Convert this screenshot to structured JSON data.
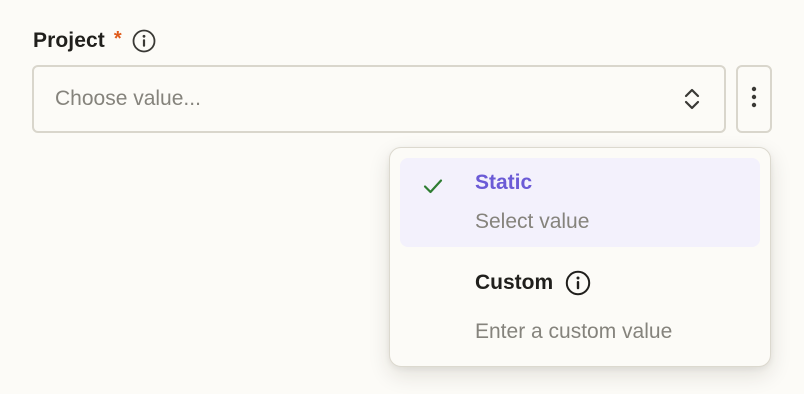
{
  "field": {
    "label": "Project",
    "required_marker": "*",
    "info_icon": "info-circle-icon"
  },
  "select": {
    "placeholder": "Choose value...",
    "chevron_icon": "chevron-up-down-icon"
  },
  "more_button": {
    "icon": "more-vertical-icon"
  },
  "menu": {
    "items": [
      {
        "title": "Static",
        "subtitle": "Select value",
        "selected": true,
        "icon": "checkmark-icon"
      },
      {
        "title": "Custom",
        "subtitle": "Enter a custom value",
        "selected": false,
        "icon": "info-circle-icon"
      }
    ]
  },
  "colors": {
    "accent": "#6b5bd6",
    "selected_bg": "#f3f1fc",
    "required": "#e05b1b",
    "check": "#2e7d32",
    "muted_text": "#85837c",
    "border": "#d9d6cc",
    "background": "#fcfbf7"
  }
}
